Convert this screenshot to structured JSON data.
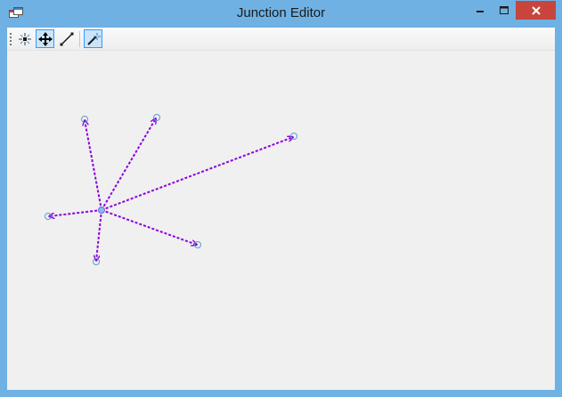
{
  "window": {
    "title": "Junction Editor",
    "accent_color": "#6fb1e3",
    "close_color": "#c7453d"
  },
  "titlebar": {
    "app_icon": "app-window-icon",
    "minimize_icon": "minimize-icon",
    "maximize_icon": "maximize-icon",
    "close_icon": "close-icon"
  },
  "toolbar": {
    "tools": [
      {
        "icon": "sparkle-icon",
        "active": false
      },
      {
        "icon": "move-icon",
        "active": true
      },
      {
        "icon": "line-icon",
        "active": false
      },
      {
        "icon": "magic-wand-icon",
        "active": true
      }
    ]
  },
  "canvas": {
    "edge_color": "#8b00e0",
    "node_color": "#5b9bd5"
  }
}
